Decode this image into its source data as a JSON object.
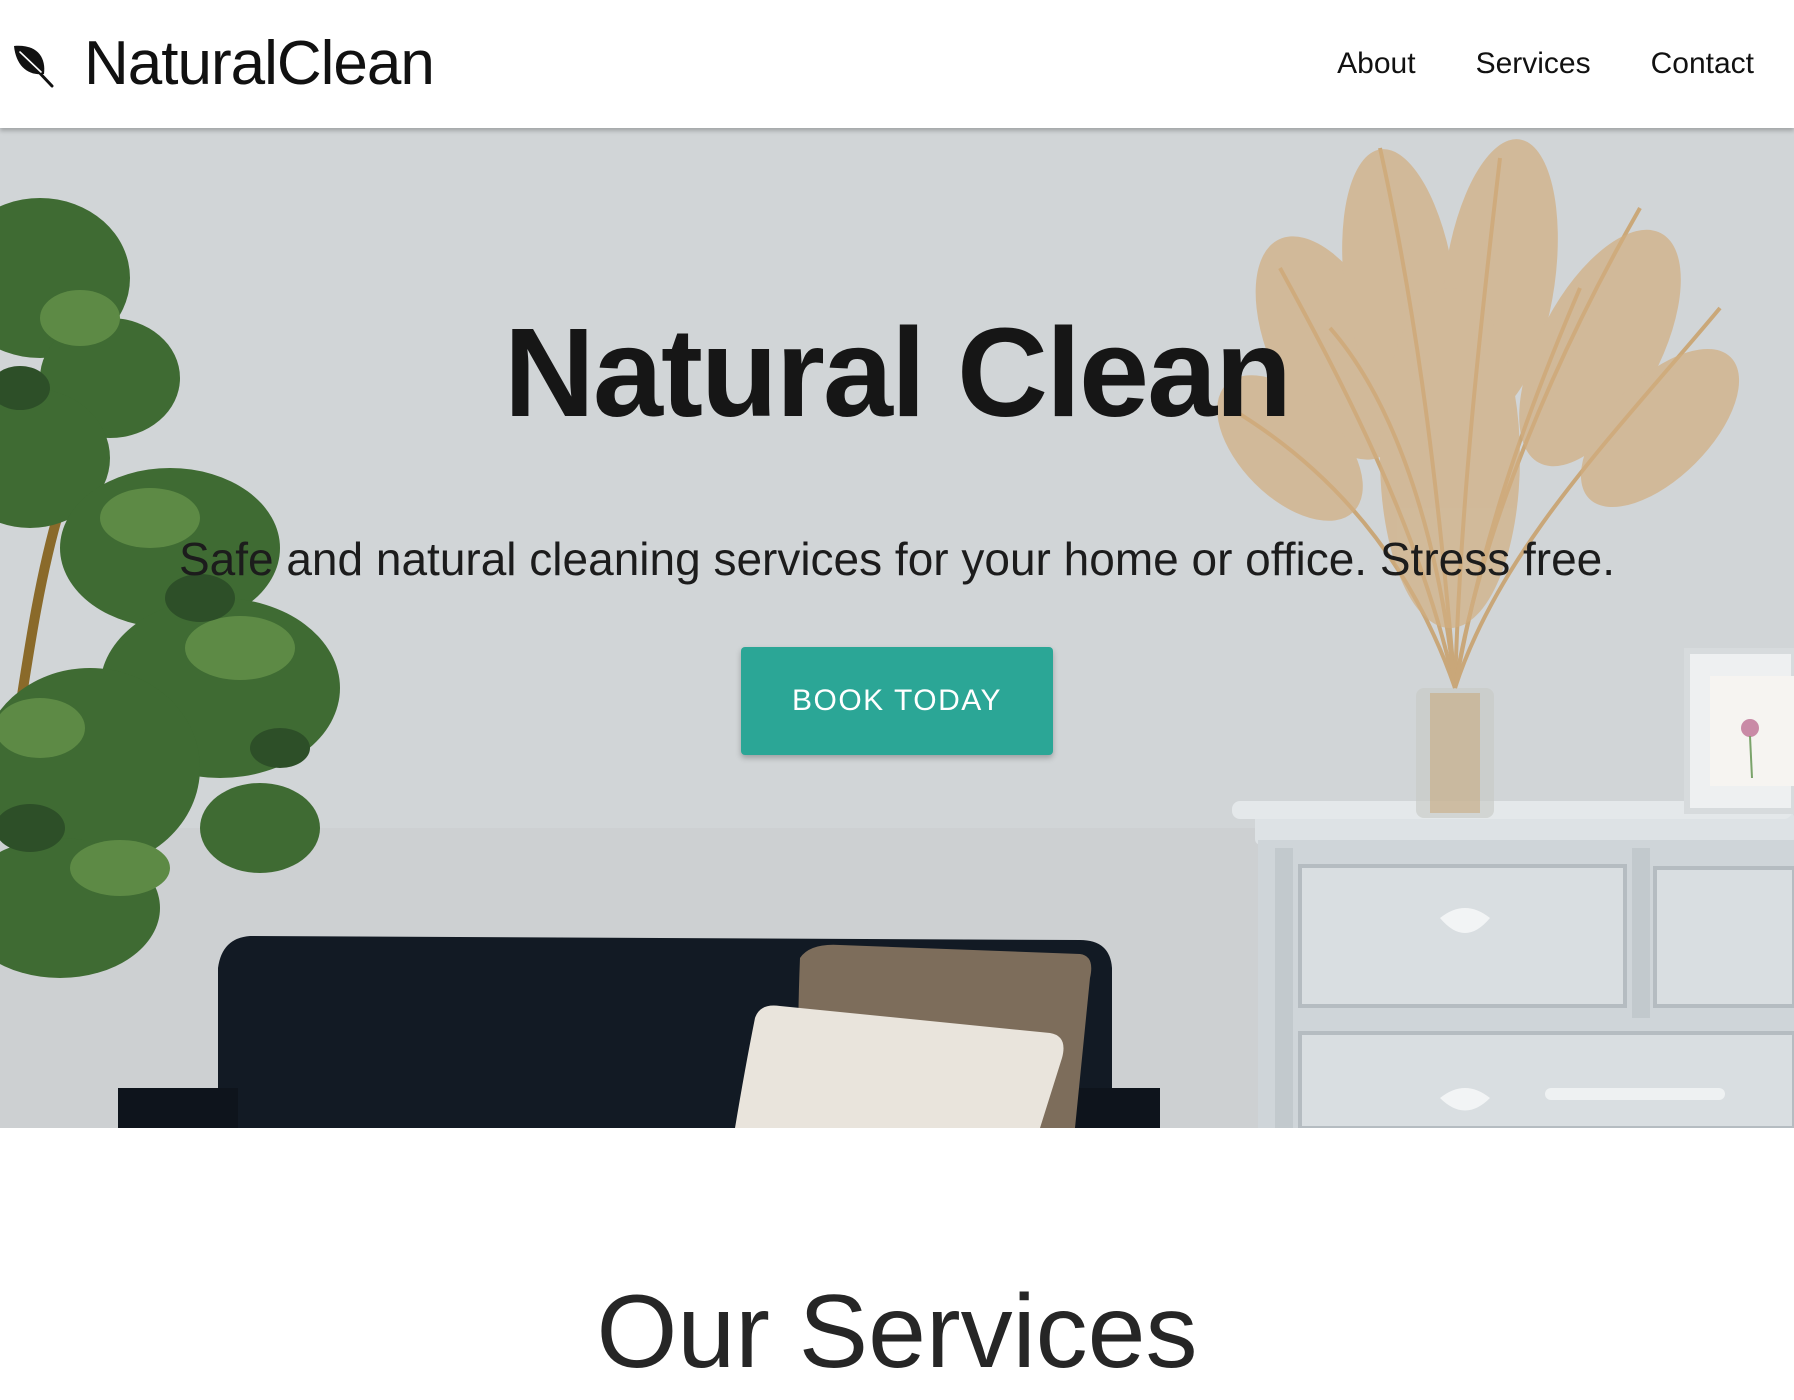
{
  "header": {
    "brand_name": "NaturalClean",
    "brand_icon": "leaf-icon",
    "nav": [
      {
        "label": "About"
      },
      {
        "label": "Services"
      },
      {
        "label": "Contact"
      }
    ]
  },
  "hero": {
    "title": "Natural Clean",
    "subtitle": "Safe and natural cleaning services for your home or office. Stress free.",
    "cta_label": "BOOK TODAY"
  },
  "services": {
    "heading": "Our Services"
  },
  "colors": {
    "accent": "#2ba696",
    "text": "#1a1a1a",
    "hero_wall": "#d0d4d6"
  }
}
